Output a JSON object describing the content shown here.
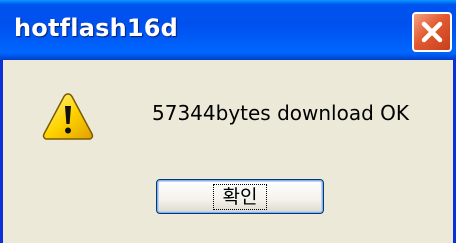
{
  "window": {
    "title": "hotflash16d"
  },
  "titlebar": {
    "close_icon": "close-icon",
    "close_color": "#e35a31"
  },
  "dialog": {
    "icon": "warning-icon",
    "message": "57344bytes download OK",
    "ok_label": "확인"
  },
  "colors": {
    "titlebar_blue": "#0053ee",
    "dialog_background": "#ece9d8",
    "warning_yellow": "#ffd700"
  }
}
